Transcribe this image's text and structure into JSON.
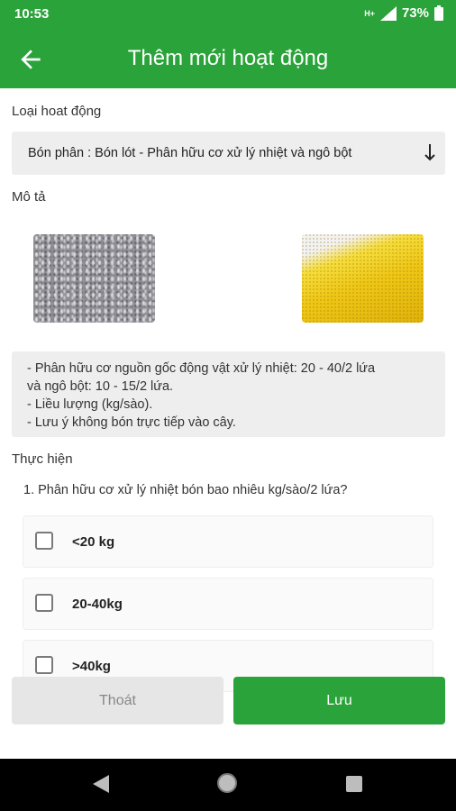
{
  "status_bar": {
    "time": "10:53",
    "network_type": "H+",
    "battery": "73%"
  },
  "app_bar": {
    "title": "Thêm mới hoạt động",
    "back_icon": "arrow-left-icon"
  },
  "form": {
    "activity_type_label": "Loại hoat động",
    "activity_type_value": "Bón phân : Bón lót - Phân hữu cơ xử lý nhiệt và ngô bột",
    "description_label": "Mô tả",
    "description_lines": [
      "- Phân hữu cơ nguồn gốc động vật xử lý nhiệt: 20 - 40/2 lứa",
      "và ngô bột: 10 - 15/2 lứa.",
      "- Liều lượng (kg/sào).",
      "- Lưu ý không bón trực tiếp vào cây."
    ],
    "perform_label": "Thực hiện",
    "question": "1. Phân hữu cơ xử lý nhiệt bón bao nhiêu kg/sào/2 lứa?",
    "options": [
      {
        "label": "<20 kg",
        "checked": false
      },
      {
        "label": "20-40kg",
        "checked": false
      },
      {
        "label": ">40kg",
        "checked": false
      }
    ]
  },
  "buttons": {
    "exit": "Thoát",
    "save": "Lưu"
  },
  "colors": {
    "primary": "#2aa33a",
    "field_background": "#eeeeee"
  }
}
